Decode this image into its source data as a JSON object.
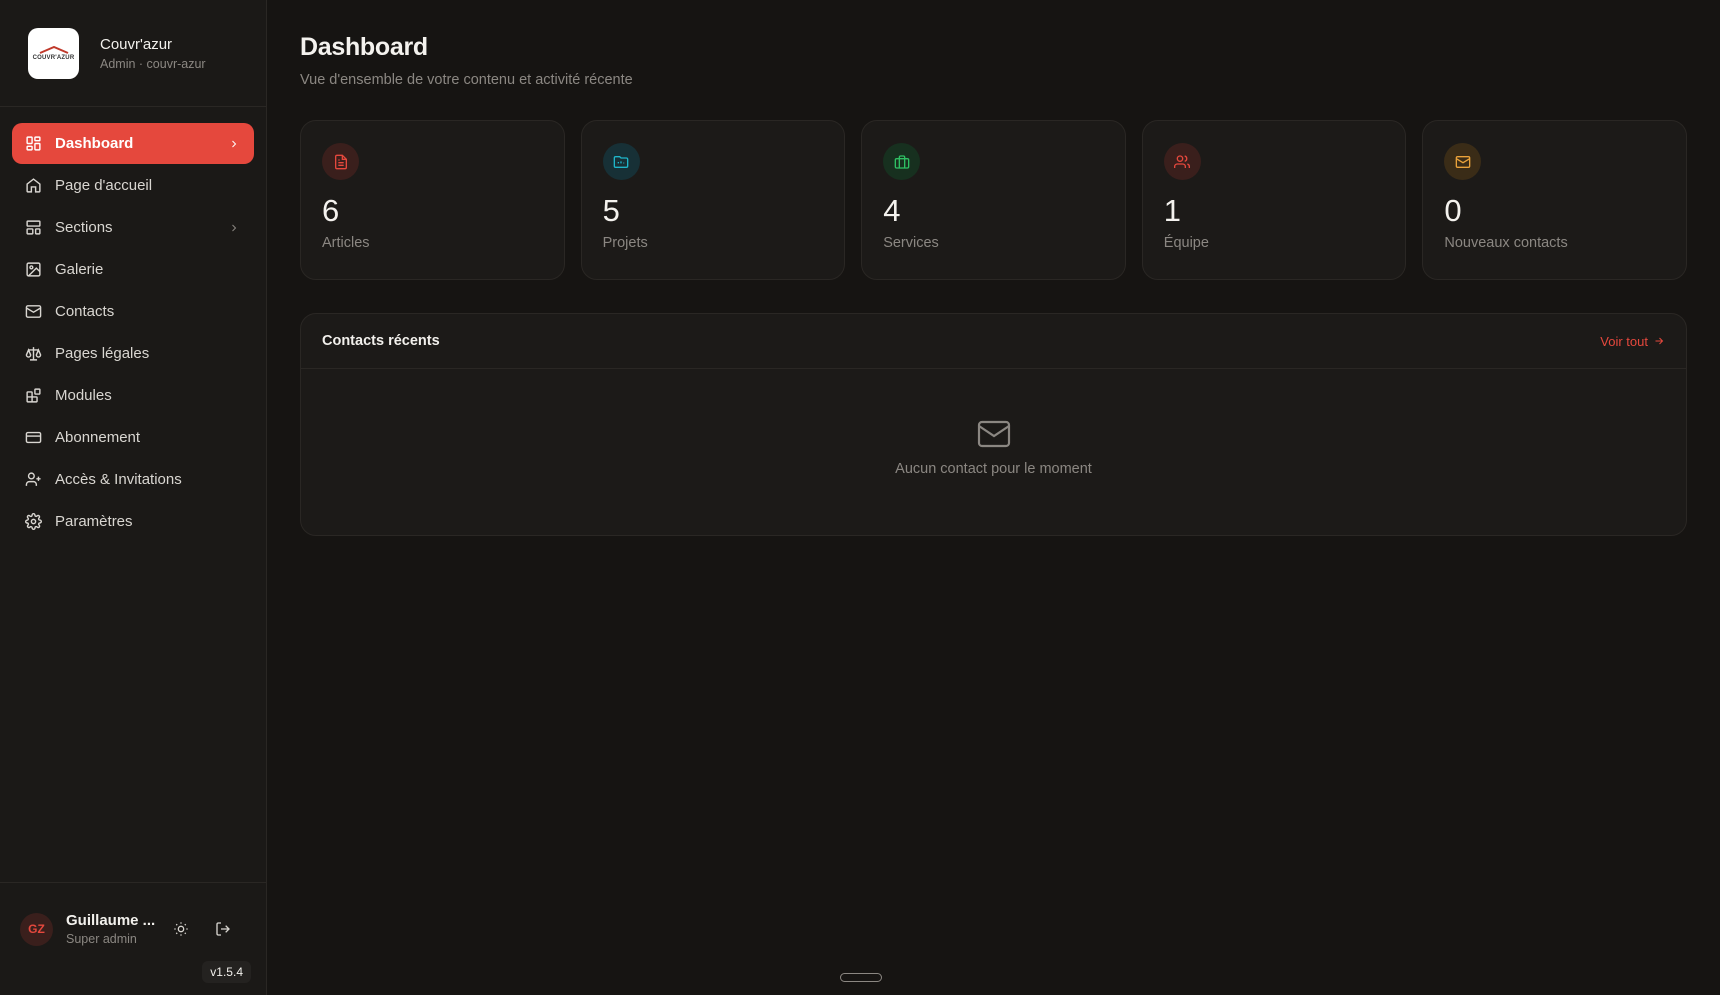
{
  "brand": {
    "name": "Couvr'azur",
    "subtitle": "Admin · couvr-azur",
    "logo_text": "COUVR'AZUR"
  },
  "sidebar": {
    "items": [
      {
        "label": "Dashboard",
        "icon": "grid-icon",
        "active": true
      },
      {
        "label": "Page d'accueil",
        "icon": "home-icon"
      },
      {
        "label": "Sections",
        "icon": "layout-icon"
      },
      {
        "label": "Galerie",
        "icon": "image-icon"
      },
      {
        "label": "Contacts",
        "icon": "mail-icon"
      },
      {
        "label": "Pages légales",
        "icon": "scale-icon"
      },
      {
        "label": "Modules",
        "icon": "blocks-icon"
      },
      {
        "label": "Abonnement",
        "icon": "credit-card-icon"
      },
      {
        "label": "Accès & Invitations",
        "icon": "user-plus-icon"
      },
      {
        "label": "Paramètres",
        "icon": "settings-icon"
      }
    ]
  },
  "user": {
    "initials": "GZ",
    "name": "Guillaume ...",
    "role": "Super admin"
  },
  "version": "v1.5.4",
  "header": {
    "title": "Dashboard",
    "subtitle": "Vue d'ensemble de votre contenu et activité récente"
  },
  "stats": [
    {
      "value": "6",
      "label": "Articles",
      "icon": "file-text-icon",
      "color": "#e5483d",
      "bg": "#3a1f1c"
    },
    {
      "value": "5",
      "label": "Projets",
      "icon": "folder-icon",
      "color": "#1fb5c9",
      "bg": "#173036"
    },
    {
      "value": "4",
      "label": "Services",
      "icon": "briefcase-icon",
      "color": "#2fbf63",
      "bg": "#17301f"
    },
    {
      "value": "1",
      "label": "Équipe",
      "icon": "users-icon",
      "color": "#e5483d",
      "bg": "#3a1f1c"
    },
    {
      "value": "0",
      "label": "Nouveaux contacts",
      "icon": "mail-icon",
      "color": "#e9a23b",
      "bg": "#3a2c17"
    }
  ],
  "recent": {
    "title": "Contacts récents",
    "see_all": "Voir tout",
    "empty_text": "Aucun contact pour le moment"
  },
  "colors": {
    "accent": "#e5483d",
    "background": "#161412",
    "sidebar": "#1b1917",
    "card": "#1c1a18"
  }
}
